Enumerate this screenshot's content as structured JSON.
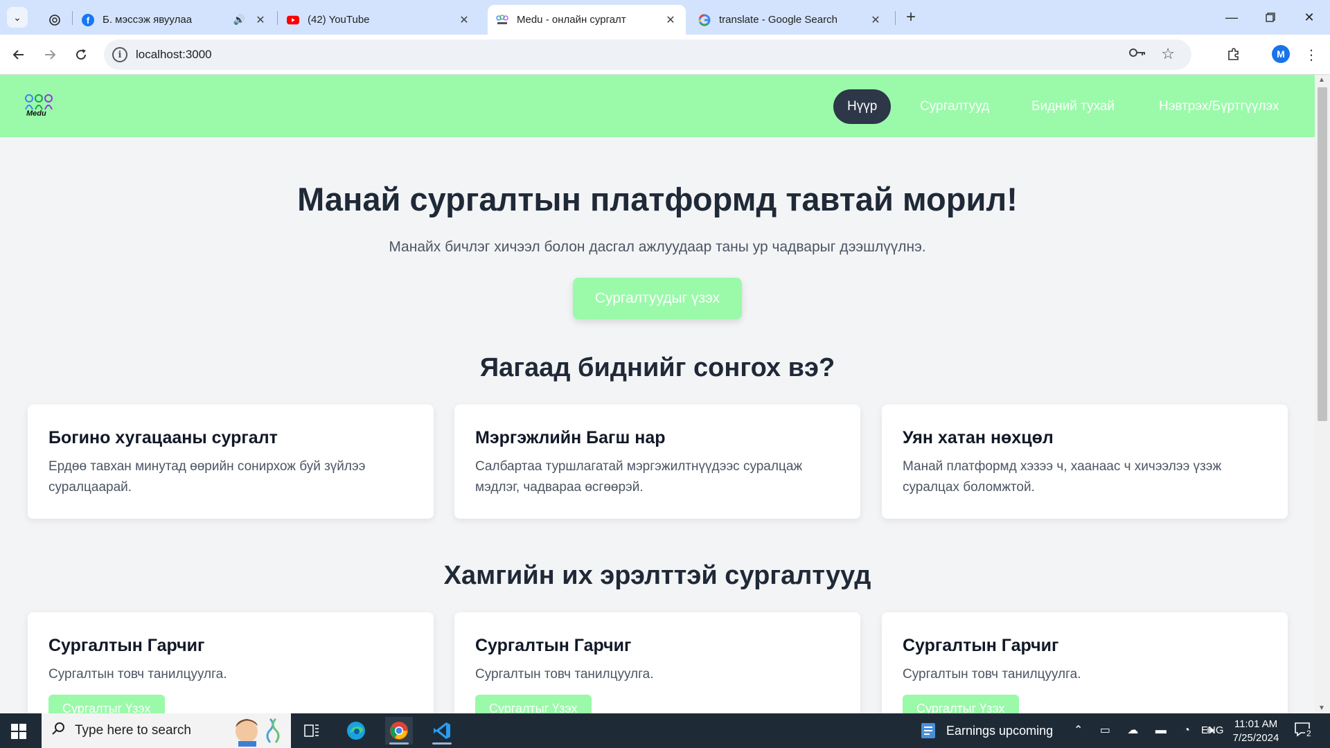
{
  "browser": {
    "tabs": [
      {
        "title": "",
        "favicon": "chatgpt-icon",
        "active": false
      },
      {
        "title": "Б. мэссэж явуулаа",
        "favicon": "facebook-icon",
        "active": false,
        "audio": true
      },
      {
        "title": "(42) YouTube",
        "favicon": "youtube-icon",
        "active": false
      },
      {
        "title": "Medu - онлайн сургалт",
        "favicon": "medu-icon",
        "active": true
      },
      {
        "title": "translate - Google Search",
        "favicon": "google-icon",
        "active": false
      }
    ],
    "url": "localhost:3000",
    "profile_initial": "M"
  },
  "site": {
    "logo_text": "Medu",
    "nav": [
      {
        "label": "Нүүр",
        "active": true
      },
      {
        "label": "Сургалтууд",
        "active": false
      },
      {
        "label": "Бидний тухай",
        "active": false
      },
      {
        "label": "Нэвтрэх/Бүртгүүлэх",
        "active": false
      }
    ],
    "hero": {
      "title": "Манай сургалтын платформд тавтай морил!",
      "subtitle": "Манайх бичлэг хичээл болон дасгал ажлуудаар таны ур чадварыг дээшлүүлнэ.",
      "cta": "Сургалтуудыг үзэх"
    },
    "why": {
      "title": "Яагаад биднийг сонгох вэ?",
      "cards": [
        {
          "title": "Богино хугацааны сургалт",
          "text": "Ердөө тавхан минутад өөрийн сонирхож буй зүйлээ суралцаарай."
        },
        {
          "title": "Мэргэжлийн Багш нар",
          "text": "Салбартаа туршлагатай мэргэжилтнүүдээс суралцаж мэдлэг, чадвараа өсгөөрэй."
        },
        {
          "title": "Уян хатан нөхцөл",
          "text": "Манай платформд хэзээ ч, хаанаас ч хичээлээ үзэж суралцах боломжтой."
        }
      ]
    },
    "popular": {
      "title": "Хамгийн их эрэлттэй сургалтууд",
      "cards": [
        {
          "title": "Сургалтын Гарчиг",
          "text": "Сургалтын товч танилцуулга.",
          "button": "Сургалтыг Үзэх"
        },
        {
          "title": "Сургалтын Гарчиг",
          "text": "Сургалтын товч танилцуулга.",
          "button": "Сургалтыг Үзэх"
        },
        {
          "title": "Сургалтын Гарчиг",
          "text": "Сургалтын товч танилцуулга.",
          "button": "Сургалтыг Үзэх"
        }
      ]
    },
    "colors": {
      "nav_bg": "#9afaa9",
      "active_pill": "#2d3748",
      "page_bg": "#f3f4f6"
    }
  },
  "taskbar": {
    "search_placeholder": "Type here to search",
    "news": "Earnings upcoming",
    "lang": "ENG",
    "time": "11:01 AM",
    "date": "7/25/2024",
    "notif_count": "2"
  }
}
